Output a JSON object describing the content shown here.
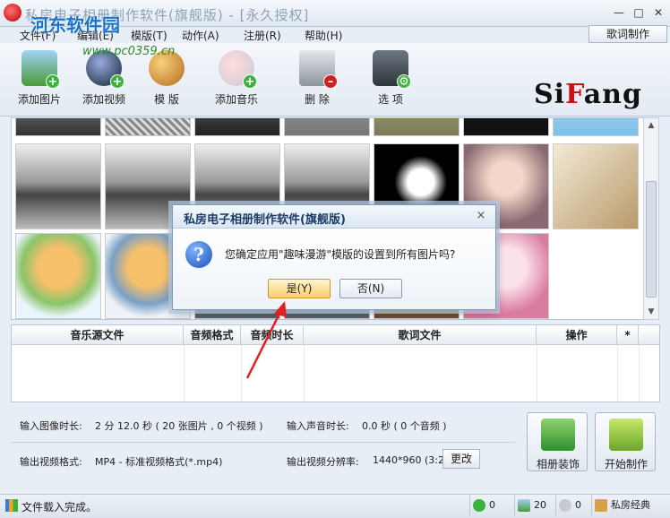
{
  "window": {
    "title": "私房电子相册制作软件(旗舰版) - [永久授权]",
    "minimize": "—",
    "maximize": "□",
    "close": "✕"
  },
  "watermark": {
    "brand": "河东软件园",
    "url": "www.pc0359.cn"
  },
  "menu": {
    "items": [
      "文件(F)",
      "编辑(E)",
      "模版(T)",
      "动作(A)",
      "注册(R)",
      "帮助(H)"
    ],
    "lyric_button": "歌词制作"
  },
  "toolbar": {
    "add_photo": "添加图片",
    "add_video": "添加视频",
    "template": "模  版",
    "add_music": "添加音乐",
    "delete": "删  除",
    "options": "选  项"
  },
  "brand_logo": {
    "part1": "Si",
    "part2": "F",
    "part3": "ang"
  },
  "music_table": {
    "columns": [
      "音乐源文件",
      "音频格式",
      "音频时长",
      "歌词文件",
      "操作",
      "*"
    ]
  },
  "info": {
    "image_duration_label": "输入图像时长:",
    "image_duration_value": "2 分 12.0 秒 ( 20 张图片 , 0 个视频 )",
    "audio_duration_label": "输入声音时长:",
    "audio_duration_value": "0.0 秒 ( 0 个音频 )",
    "video_format_label": "输出视频格式:",
    "video_format_value": "MP4 - 标准视频格式(*.mp4)",
    "resolution_label": "输出视频分辨率:",
    "resolution_value": "1440*960 (3:2)",
    "change_button": "更改",
    "decorate_button": "相册装饰",
    "start_button": "开始制作"
  },
  "status": {
    "text": "文件载入完成。",
    "count_a": "0",
    "count_b": "20",
    "count_c": "0",
    "brand": "私房经典"
  },
  "dialog": {
    "title": "私房电子相册制作软件(旗舰版)",
    "close": "×",
    "icon": "?",
    "message": "您确定应用\"趣味漫游\"模版的设置到所有图片吗?",
    "yes": "是(Y)",
    "no": "否(N)"
  },
  "colors": {
    "accent": "#1a74c9",
    "brand_red": "#d01010",
    "primary_button": "#f8cf6a"
  }
}
